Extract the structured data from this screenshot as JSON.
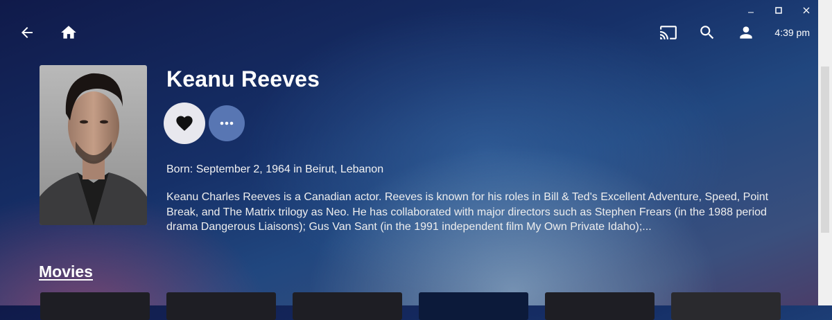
{
  "window": {
    "controls": [
      "minimize",
      "maximize",
      "close"
    ]
  },
  "topbar": {
    "left_icons": [
      "back-arrow-icon",
      "home-icon"
    ],
    "right_icons": [
      "cast-icon",
      "search-icon",
      "user-icon"
    ],
    "time": "4:39 pm"
  },
  "person": {
    "name": "Keanu Reeves",
    "born": "Born: September 2, 1964 in Beirut, Lebanon",
    "bio": "Keanu Charles Reeves is a Canadian actor. Reeves is known for his roles in Bill & Ted's Excellent Adventure, Speed, Point Break, and The Matrix trilogy as Neo. He has collaborated with major directors such as Stephen Frears (in the 1988 period drama Dangerous Liaisons); Gus Van Sant (in the 1991 independent film My Own Private Idaho);..."
  },
  "actions": {
    "favorite_icon": "heart-icon",
    "more_icon": "more-horizontal-icon"
  },
  "movies": {
    "title": "Movies",
    "card_count": 6
  },
  "colors": {
    "fav_button_bg": "#e8e8ee",
    "more_button_bg": "#5876b3"
  }
}
